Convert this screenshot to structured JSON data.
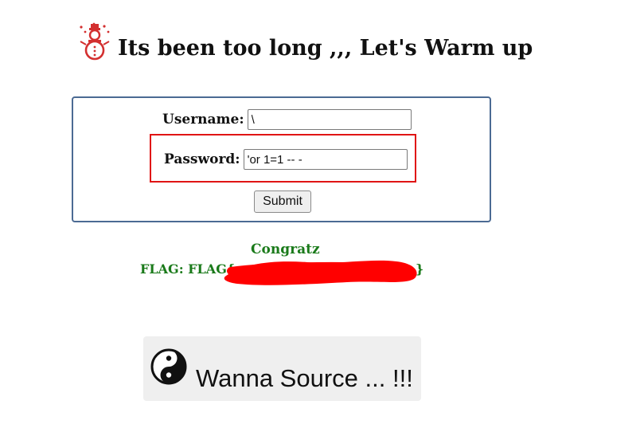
{
  "header": {
    "icon": "snowman-icon",
    "title": "Its been too long ,,, Let's Warm up"
  },
  "form": {
    "username_label": "Username:",
    "username_value": "\\",
    "password_label": "Password:",
    "password_value": "'or 1=1 -- -",
    "submit_label": "Submit"
  },
  "result": {
    "message": "Congratz",
    "flag_prefix": "FLAG: FLAG{",
    "flag_suffix": "}",
    "redaction_color": "#ff0000"
  },
  "source_button": {
    "icon": "yin-yang-icon",
    "label": "Wanna Source ... !!!"
  },
  "colors": {
    "accent_green": "#1a7a1a",
    "highlight_red": "#e01414",
    "form_border": "#4b6a93"
  }
}
